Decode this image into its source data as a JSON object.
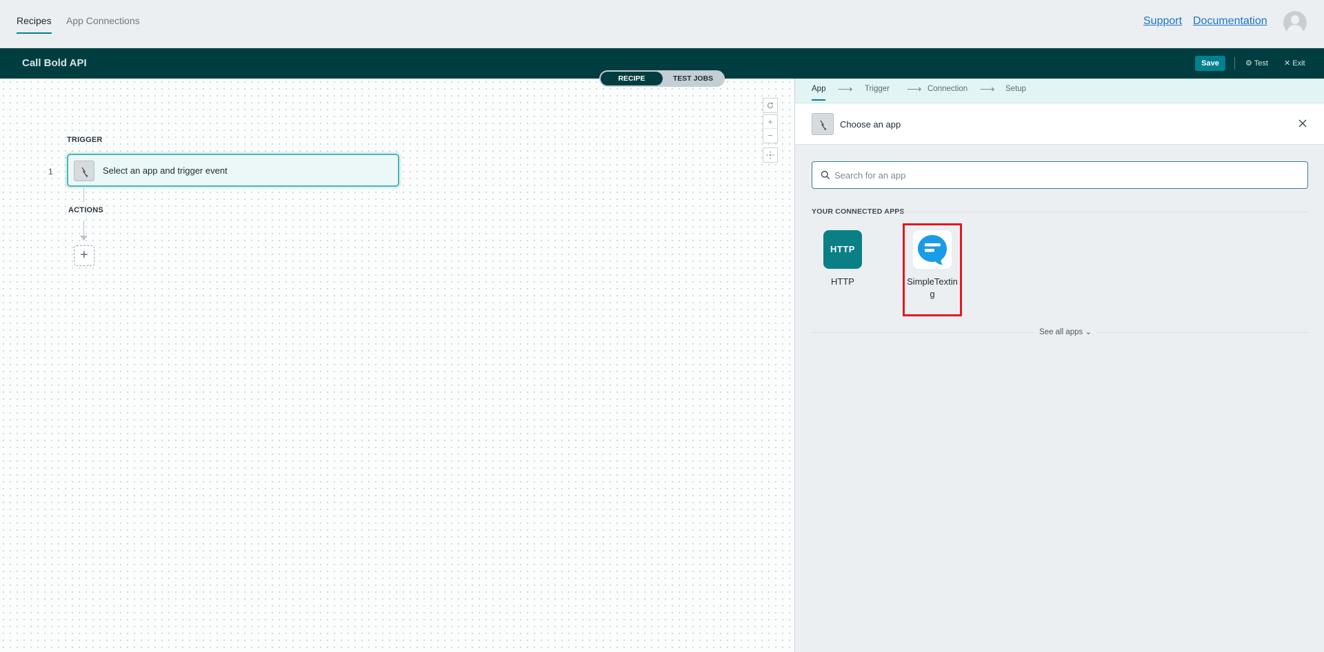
{
  "topnav": {
    "tabs": [
      {
        "label": "Recipes",
        "active": true
      },
      {
        "label": "App Connections",
        "active": false
      }
    ],
    "links": {
      "support": "Support",
      "documentation": "Documentation"
    }
  },
  "header": {
    "title": "Call Bold API",
    "save_label": "Save",
    "test_label": "Test",
    "exit_label": "Exit",
    "toggle": {
      "recipe": "RECIPE",
      "test_jobs": "TEST JOBS"
    }
  },
  "canvas": {
    "trigger_label": "TRIGGER",
    "actions_label": "ACTIONS",
    "step_number": "1",
    "trigger_text": "Select an app and trigger event"
  },
  "panel": {
    "wizard_steps": [
      {
        "label": "App",
        "active": true
      },
      {
        "label": "Trigger",
        "active": false
      },
      {
        "label": "Connection",
        "active": false
      },
      {
        "label": "Setup",
        "active": false
      }
    ],
    "choose_title": "Choose an app",
    "search_placeholder": "Search for an app",
    "connected_label": "YOUR CONNECTED APPS",
    "apps": [
      {
        "name": "HTTP",
        "logo_text": "HTTP",
        "color": "#0a7f85"
      },
      {
        "name": "SimpleTexting",
        "color": "#1a9be6"
      }
    ],
    "see_all_label": "See all apps"
  },
  "colors": {
    "accent": "#00838f",
    "header_bg": "#003d40",
    "highlight": "#e3181f"
  }
}
